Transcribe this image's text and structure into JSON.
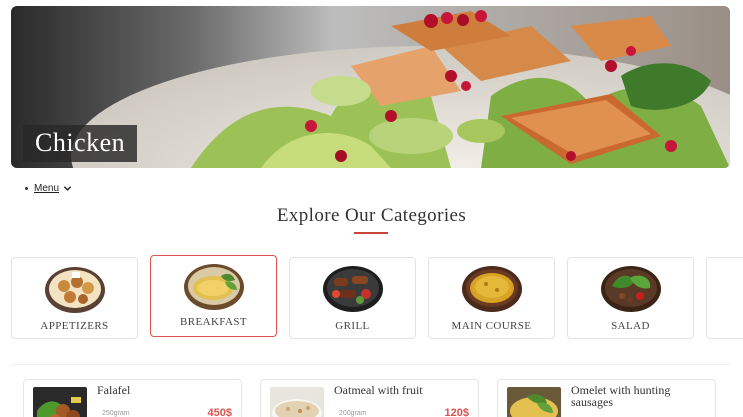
{
  "hero": {
    "title": "Chicken"
  },
  "nav": {
    "menu_label": "Menu"
  },
  "section": {
    "title": "Explore Our Categories"
  },
  "categories": [
    {
      "label": "APPETIZERS",
      "icon": "appetizers-plate-icon",
      "active": false
    },
    {
      "label": "BREAKFAST",
      "icon": "breakfast-plate-icon",
      "active": true
    },
    {
      "label": "GRILL",
      "icon": "grill-plate-icon",
      "active": false
    },
    {
      "label": "MAIN COURSE",
      "icon": "main-course-plate-icon",
      "active": false
    },
    {
      "label": "SALAD",
      "icon": "salad-plate-icon",
      "active": false
    }
  ],
  "items": [
    {
      "name": "Falafel",
      "weight": "250gram",
      "price": "450$"
    },
    {
      "name": "Oatmeal with fruit",
      "weight": "200gram",
      "price": "120$"
    },
    {
      "name": "Omelet with hunting sausages",
      "weight": "",
      "price": ""
    }
  ],
  "colors": {
    "accent": "#d9534f",
    "underline": "#c9453c",
    "text": "#333333"
  }
}
